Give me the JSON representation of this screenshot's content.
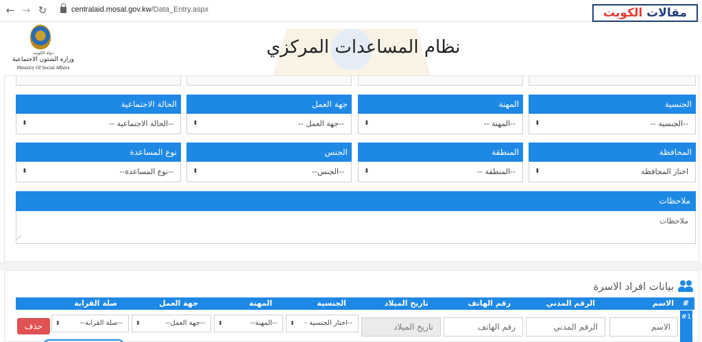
{
  "browser": {
    "url_host": "centralaid.mosal.gov.kw",
    "url_path": "/Data_Entry.aspx",
    "back_glyph": "←",
    "forward_glyph": "→",
    "reload_glyph": "↻"
  },
  "badge": {
    "part1": "مقالات",
    "part2": "الكويت"
  },
  "logo": {
    "line1": "دولة الكويت",
    "line2": "وزارة الشئون الاجتماعية",
    "line3": "Ministry Of Social Affairs"
  },
  "page_title": "نظام المساعدات المركزي",
  "form": {
    "row1": [
      {
        "label": "الجنسية",
        "value": "--الجنسية --"
      },
      {
        "label": "المهنة",
        "value": "--المهنة --"
      },
      {
        "label": "جهة العمل",
        "value": "--جهة العمل --"
      },
      {
        "label": "الحالة الاجتماعية",
        "value": "--الحالة الاجتماعية --"
      }
    ],
    "row2": [
      {
        "label": "المحافظة",
        "value": "اختار المحافظة"
      },
      {
        "label": "المنطقة",
        "value": "--المنطقة --"
      },
      {
        "label": "الجنس",
        "value": "--الجنس--"
      },
      {
        "label": "نوع المساعدة",
        "value": "--نوع المساعدة--"
      }
    ],
    "notes_label": "ملاحظات",
    "notes_placeholder": "ملاحظات"
  },
  "family": {
    "title": "بيانات افراد الاسرة",
    "columns": [
      "#",
      "الاسم",
      "الرقم المدني",
      "رقم الهاتف",
      "تاريخ الميلاد",
      "الجنسية",
      "المهنة",
      "جهة العمل",
      "صلة القرابة"
    ],
    "row": {
      "num": "#1",
      "name_placeholder": "الاسم",
      "civil_placeholder": "الرقم المدني",
      "phone_placeholder": "رقم الهاتف",
      "dob_placeholder": "تاريخ الميلاد",
      "nationality": "--اختار الجنسية -",
      "job": "--المهنة--",
      "employer": "--جهة العمل--",
      "relation": "--صلة القرابة--",
      "delete_label": "حذف"
    }
  },
  "colors": {
    "primary": "#1e88e5",
    "danger": "#e05252",
    "badge": "#1f3d7a"
  }
}
